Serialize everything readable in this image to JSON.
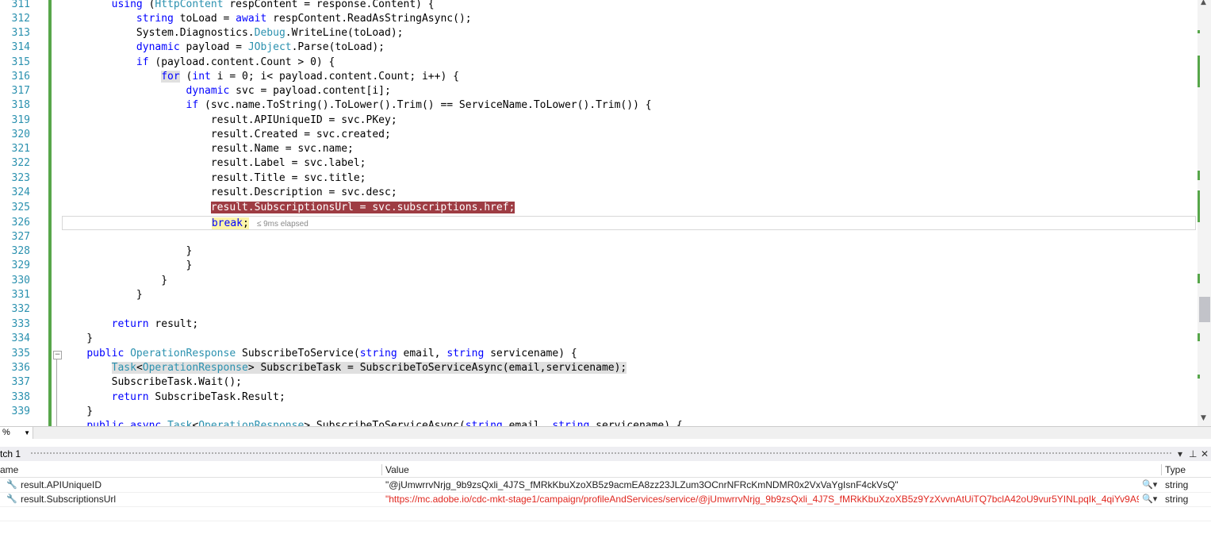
{
  "editor": {
    "line_numbers": [
      "311",
      "312",
      "313",
      "314",
      "315",
      "316",
      "317",
      "318",
      "319",
      "320",
      "321",
      "322",
      "323",
      "324",
      "325",
      "326",
      "327",
      "328",
      "329",
      "330",
      "331",
      "332",
      "333",
      "334",
      "335",
      "336",
      "337",
      "338",
      "339"
    ],
    "elapsed_hint": "≤ 9ms elapsed"
  },
  "zoom": {
    "value": "%"
  },
  "watch": {
    "title": "tch 1",
    "columns": {
      "name": "ame",
      "value": "Value",
      "type": "Type"
    },
    "rows": [
      {
        "name": "result.APIUniqueID",
        "value": "\"@jUmwrrvNrjg_9b9zsQxli_4J7S_fMRkKbuXzoXB5z9acmEA8zz23JLZum3OCnrNFRcKmNDMR0x2VxVaYgIsnF4ckVsQ\"",
        "type": "string",
        "value_color": "#1e1e1e"
      },
      {
        "name": "result.SubscriptionsUrl",
        "value": "\"https://mc.adobe.io/cdc-mkt-stage1/campaign/profileAndServices/service/@jUmwrrvNrjg_9b9zsQxli_4J7S_fMRkKbuXzoXB5z9YzXvvnAtUiTQ7bclA42oU9vur5YINLpqIk_4qiYv9A9juxl",
        "type": "string",
        "value_color": "#e0271f"
      }
    ]
  },
  "colors": {
    "keyword": "#0000ff",
    "type": "#2b91af",
    "breakpoint": "#9e3c43",
    "change_bar": "#57a64a"
  }
}
